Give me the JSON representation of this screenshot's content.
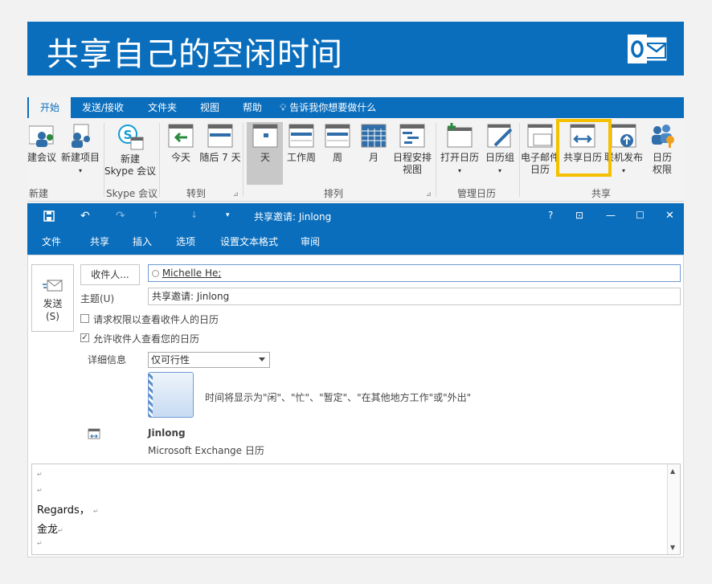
{
  "banner": {
    "title": "共享自己的空闲时间"
  },
  "ribbon_tabs": [
    "开始",
    "发送/接收",
    "文件夹",
    "视图",
    "帮助"
  ],
  "tell_me": "告诉我你想要做什么",
  "ribbon": {
    "buttons": {
      "new_meeting": "建会议",
      "new_items": "新建项目",
      "skype_line1": "新建",
      "skype_line2": "Skype 会议",
      "today": "今天",
      "next7": "随后 7 天",
      "day": "天",
      "workweek": "工作周",
      "week": "周",
      "month": "月",
      "schedule_line1": "日程安排",
      "schedule_line2": "视图",
      "open_cal": "打开日历",
      "cal_groups": "日历组",
      "email_cal_line1": "电子邮件",
      "email_cal_line2": "日历",
      "share_cal": "共享日历",
      "publish": "联机发布",
      "perm_line1": "日历",
      "perm_line2": "权限"
    },
    "groups": {
      "new": "新建",
      "skype": "Skype 会议",
      "goto": "转到",
      "arrange": "排列",
      "manage": "管理日历",
      "share": "共享"
    }
  },
  "message": {
    "title": "共享邀请: Jinlong",
    "window_controls": {
      "help": "?",
      "minimize": "—",
      "maximize": "☐",
      "close": "✕"
    },
    "menu": [
      "文件",
      "共享",
      "插入",
      "选项",
      "设置文本格式",
      "审阅"
    ],
    "send_label": "发送",
    "send_shortcut": "(S)",
    "to_button": "收件人...",
    "to_value": "Michelle He;",
    "subject_label": "主题(U)",
    "subject_value": "共享邀请: Jinlong",
    "request_permission": "请求权限以查看收件人的日历",
    "allow_view": "允许收件人查看您的日历",
    "details_label": "详细信息",
    "details_value": "仅可行性",
    "details_description": "时间将显示为\"闲\"、\"忙\"、\"暂定\"、\"在其他地方工作\"或\"外出\"",
    "calendar_owner": "Jinlong",
    "calendar_source": "Microsoft Exchange 日历",
    "body_lines": [
      "Regards，",
      "金龙"
    ]
  },
  "colors": {
    "brand": "#0a6ebd",
    "highlight": "#f5c000",
    "ribbon_bg": "#f3f3f3"
  },
  "icons": [
    "outlook-logo",
    "skype-icon",
    "calendar-icon",
    "share-arrow-icon",
    "publish-icon",
    "permissions-icon",
    "save-icon",
    "undo-icon",
    "redo-icon",
    "send-icon"
  ]
}
